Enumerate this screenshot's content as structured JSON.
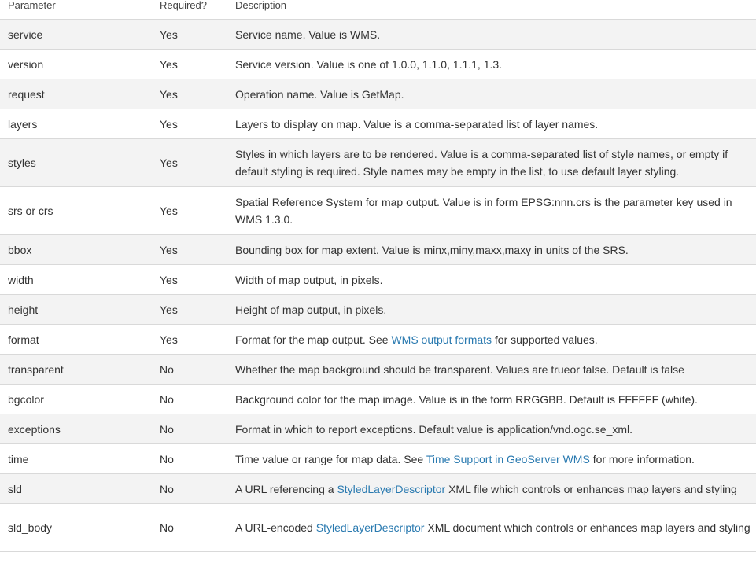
{
  "table": {
    "headers": {
      "parameter": "Parameter",
      "required": "Required?",
      "description": "Description"
    },
    "rows": [
      {
        "param": "service",
        "required": "Yes",
        "desc_pre": "Service name. Value is WMS."
      },
      {
        "param": "version",
        "required": "Yes",
        "desc_pre": "Service version. Value is one of 1.0.0, 1.1.0, 1.1.1, 1.3."
      },
      {
        "param": "request",
        "required": "Yes",
        "desc_pre": "Operation name. Value is GetMap."
      },
      {
        "param": "layers",
        "required": "Yes",
        "desc_pre": "Layers to display on map. Value is a comma-separated list of layer names."
      },
      {
        "param": "styles",
        "required": "Yes",
        "desc_pre": "Styles in which layers are to be rendered. Value is a comma-separated list of style names, or empty if default styling is required. Style names may be empty in the list, to use default layer styling."
      },
      {
        "param": "srs or crs",
        "required": "Yes",
        "desc_pre": "Spatial Reference System for map output. Value is in form EPSG:nnn.crs is the parameter key used in WMS 1.3.0."
      },
      {
        "param": "bbox",
        "required": "Yes",
        "desc_pre": "Bounding box for map extent. Value is minx,miny,maxx,maxy in units of the SRS."
      },
      {
        "param": "width",
        "required": "Yes",
        "desc_pre": "Width of map output, in pixels."
      },
      {
        "param": "height",
        "required": "Yes",
        "desc_pre": "Height of map output, in pixels."
      },
      {
        "param": "format",
        "required": "Yes",
        "desc_pre": "Format for the map output. See ",
        "link": "WMS output formats",
        "desc_post": " for supported values."
      },
      {
        "param": "transparent",
        "required": "No",
        "desc_pre": "Whether the map background should be transparent. Values are trueor false. Default is false"
      },
      {
        "param": "bgcolor",
        "required": "No",
        "desc_pre": "Background color for the map image. Value is in the form RRGGBB. Default is FFFFFF (white)."
      },
      {
        "param": "exceptions",
        "required": "No",
        "desc_pre": "Format in which to report exceptions. Default value is application/vnd.ogc.se_xml."
      },
      {
        "param": "time",
        "required": "No",
        "desc_pre": "Time value or range for map data. See ",
        "link": "Time Support in GeoServer WMS",
        "desc_post": " for more information."
      },
      {
        "param": "sld",
        "required": "No",
        "desc_pre": "A URL referencing a ",
        "link": "StyledLayerDescriptor",
        "desc_post": " XML file which controls or enhances map layers and styling"
      },
      {
        "param": "sld_body",
        "required": "No",
        "desc_pre": "A URL-encoded ",
        "link": "StyledLayerDescriptor",
        "desc_post": " XML document which controls or enhances map layers and styling"
      }
    ]
  },
  "colors": {
    "link": "#2a7ab0",
    "stripe": "#f3f3f3",
    "border": "#d9d9d9",
    "text": "#333333"
  }
}
